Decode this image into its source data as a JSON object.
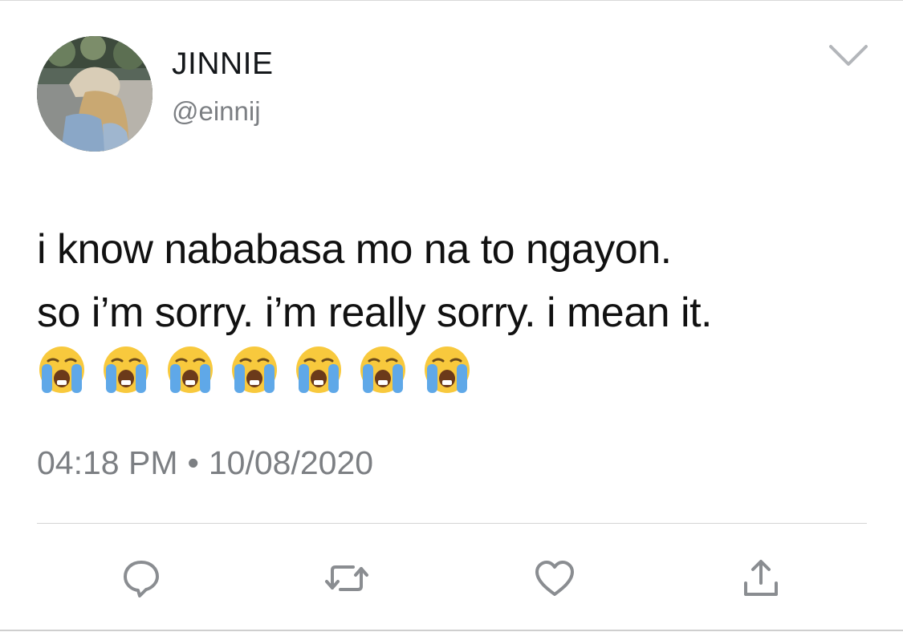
{
  "author": {
    "display_name": "JINNIE",
    "handle": "@einnij",
    "avatar_icon": "profile-photo"
  },
  "tweet": {
    "lines": [
      "i know nababasa mo na to ngayon.",
      "so i’m sorry. i’m really sorry. i mean it."
    ],
    "emoji": [
      "😭",
      "😭",
      "😭",
      "😭",
      "😭",
      "😭",
      "😭"
    ],
    "emoji_icon": "loudly-crying-face-icon"
  },
  "meta": {
    "time": "04:18 PM",
    "separator": "•",
    "date": "10/08/2020"
  },
  "actions": {
    "reply_icon": "reply-icon",
    "retweet_icon": "retweet-icon",
    "like_icon": "heart-icon",
    "share_icon": "share-icon"
  },
  "colors": {
    "text_primary": "#14171a",
    "text_secondary": "#7c7f83",
    "icon_gray": "#8a8d91",
    "divider": "#d4d4d4"
  }
}
